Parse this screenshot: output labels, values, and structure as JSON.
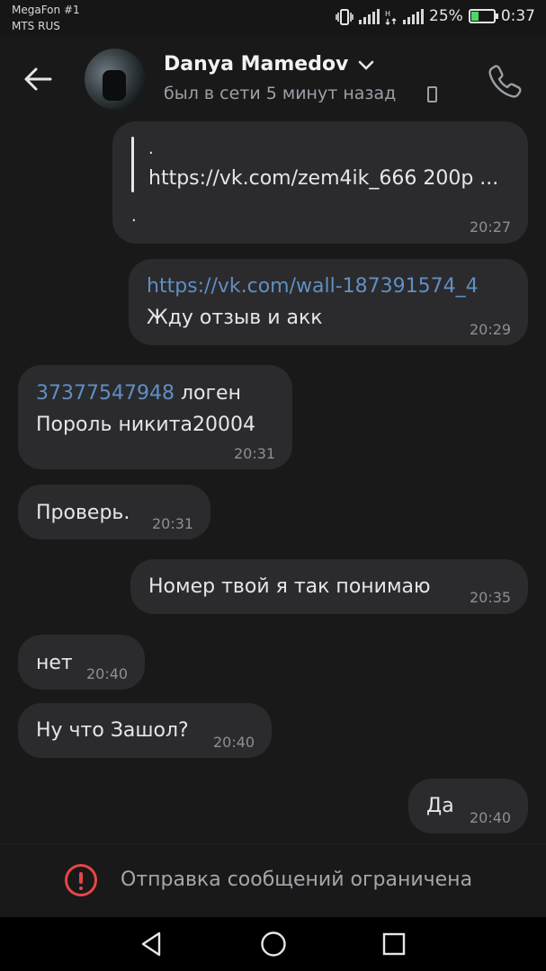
{
  "status_bar": {
    "carrier_primary": "MegaFon #1",
    "carrier_secondary": "MTS RUS",
    "battery_percent": "25%",
    "clock": "0:37",
    "icons": [
      "vibrate-icon",
      "signal-icon",
      "data-signal-icon",
      "signal-icon",
      "battery-charging-icon"
    ]
  },
  "header": {
    "contact_name": "Danya Mamedov",
    "status": "был в сети 5 минут назад",
    "icons": [
      "back-arrow-icon",
      "chevron-down-icon",
      "mobile-device-icon",
      "phone-call-icon"
    ]
  },
  "messages": [
    {
      "direction": "out",
      "lines": [
        ".",
        "https://vk.com/zem4ik_666 200р ...",
        "."
      ],
      "time": "20:27"
    },
    {
      "direction": "out",
      "link": "https://vk.com/wall-187391574_4",
      "text": "Жду отзыв и акк",
      "time": "20:29"
    },
    {
      "direction": "in",
      "link": "37377547948",
      "text_after_link": " логен",
      "text": "Пороль никита20004",
      "time": "20:31"
    },
    {
      "direction": "in",
      "text": "Проверь.",
      "time": "20:31"
    },
    {
      "direction": "out",
      "text": "Номер твой я так понимаю",
      "time": "20:35"
    },
    {
      "direction": "in",
      "text": "нет",
      "time": "20:40"
    },
    {
      "direction": "in",
      "text": "Ну что Зашол?",
      "time": "20:40"
    },
    {
      "direction": "out",
      "text": "Да",
      "time": "20:40"
    }
  ],
  "footer": {
    "restriction_text": "Отправка сообщений ограничена",
    "icon": "alert-circle-icon",
    "accent": "#e64646"
  },
  "nav_bar": {
    "icons": [
      "nav-back-icon",
      "nav-home-icon",
      "nav-recents-icon"
    ]
  },
  "colors": {
    "background": "#19191a",
    "bubble": "#2b2b2d",
    "link": "#5f8fc4",
    "muted_text": "#8c8f93"
  }
}
